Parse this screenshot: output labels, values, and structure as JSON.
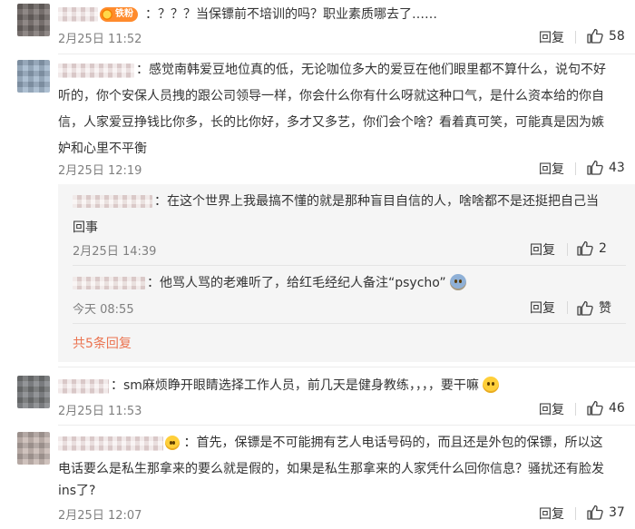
{
  "comments": [
    {
      "text": "：？？？当保镖前不培训的吗？职业素质哪去了……",
      "badge": "铁粉",
      "time": "2月25日 11:52",
      "reply": "回复",
      "likes": "58"
    },
    {
      "text_l1": "：感觉南韩爱豆地位真的低，无论咖位多大的爱豆在他们眼里都不算什么，说句不好",
      "text_l2": "听的，你个安保人员拽的跟公司领导一样，你会什么你有什么呀就这种口气，是什么资本给的你自",
      "text_l3": "信，人家爱豆挣钱比你多，长的比你好，多才又多艺，你们会个啥？看着真可笑，可能真是因为嫉",
      "text_l4": "妒和心里不平衡",
      "time": "2月25日 12:19",
      "reply": "回复",
      "likes": "43",
      "sub_replies": [
        {
          "text_l1": "：在这个世界上我最搞不懂的就是那种盲目自信的人，啥啥都不是还挺把自己当",
          "text_l2": "回事",
          "time": "2月25日 14:39",
          "reply": "回复",
          "likes": "2"
        },
        {
          "text": "：他骂人骂的老难听了，给红毛经纪人备注“psycho”",
          "time": "今天 08:55",
          "reply": "回复",
          "likes": "赞"
        }
      ],
      "more_link": "共5条回复"
    },
    {
      "text": "：sm麻烦睁开眼睛选择工作人员，前几天是健身教练，，，，要干嘛",
      "time": "2月25日 11:53",
      "reply": "回复",
      "likes": "46"
    },
    {
      "text_l1": "：首先，保镖是不可能拥有艺人电话号码的，而且还是外包的保镖，所以这",
      "text_l2": "电话要么是私生那拿来的要么就是假的，如果是私生那拿来的人家凭什么回你信息？骚扰还有脸发",
      "text_l3": "ins了?",
      "time": "2月25日 12:07",
      "reply": "回复",
      "likes": "37"
    }
  ]
}
